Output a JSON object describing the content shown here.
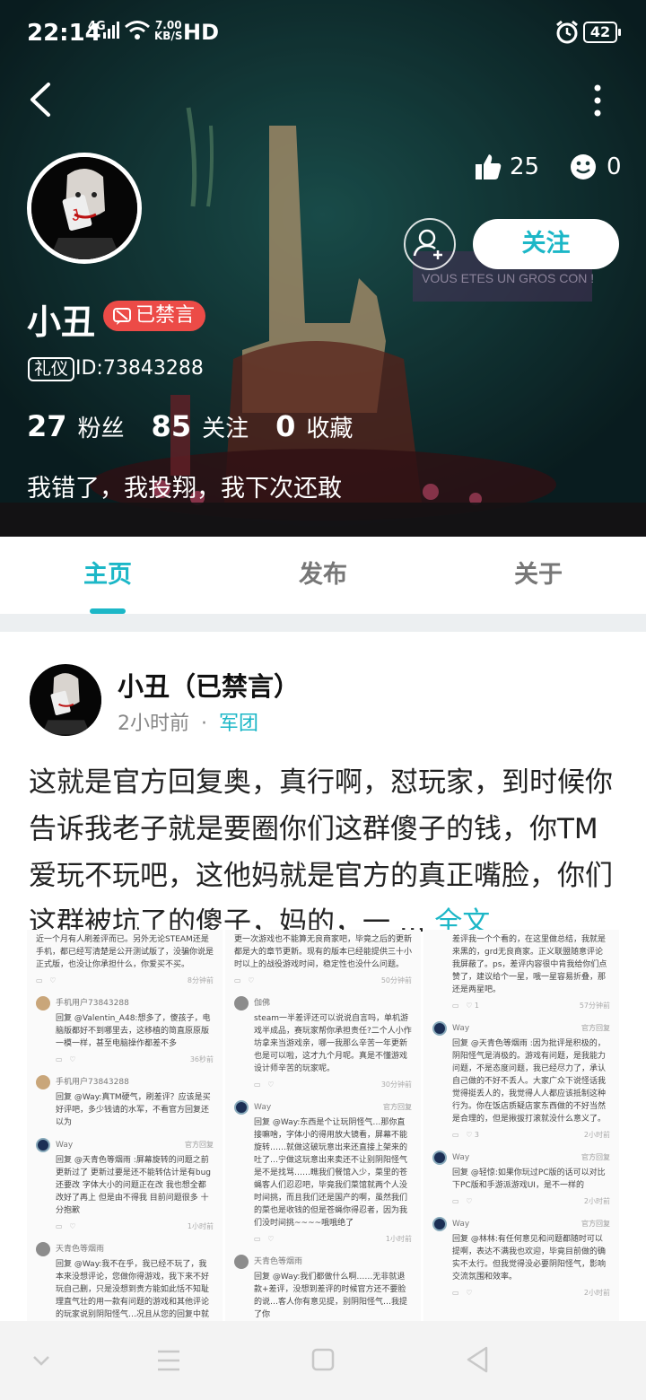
{
  "status_bar": {
    "time": "22:14",
    "network": "4G",
    "speed_value": "7.00",
    "speed_unit": "KB/S",
    "hd": "HD",
    "battery": "42"
  },
  "profile": {
    "name": "小丑",
    "banned_label": "已禁言",
    "etiquette_tag": "礼仪",
    "user_id": "ID:73843288",
    "likes": "25",
    "smiles": "0",
    "follow_label": "关注",
    "stats": [
      {
        "num": "27",
        "label": "粉丝"
      },
      {
        "num": "85",
        "label": "关注"
      },
      {
        "num": "0",
        "label": "收藏"
      }
    ],
    "signature": "我错了，我投翔，我下次还敢",
    "bg_sign_text": "VOUS ETES UN GROS CON !"
  },
  "tabs": [
    {
      "label": "主页",
      "active": true
    },
    {
      "label": "发布",
      "active": false
    },
    {
      "label": "关于",
      "active": false
    }
  ],
  "post": {
    "author": "小丑（已禁言）",
    "time": "2小时前",
    "separator": "·",
    "group": "军团",
    "text": "这就是官方回复奥，真行啊，怼玩家，到时候你告诉我老子就是要圈你们这群傻子的钱，你TM爱玩不玩吧，这他妈就是官方的真正嘴脸，你们这群被坑了的傻子，妈的，一 ... ",
    "full_text_link": "全文"
  },
  "gallery": {
    "col1": {
      "c1_body": "近一个月有人刷差评而已。另外无论STEAM还是手机，都已经写清楚是公开测试版了，没骗你说是正式版，也没让你承担什么，你爱买不买。",
      "c1_time": "8分钟前",
      "c2_user": "手机用户73843288",
      "c2_body": "回复 @Valentin_A48:想多了，傻孩子，电脑版都好不到哪里去，这移植的简直原原版一模一样，甚至电脑操作都差不多",
      "c2_time": "36秒前",
      "c3_user": "手机用户73843288",
      "c3_body": "回复 @Way:真TM硬气，刷差评？应该是买好评吧，多少钱请的水军，不看官方回复还以为",
      "c4_user": "Way",
      "c4_official": "官方回复",
      "c4_body": "回复 @天青色等烟雨 :屏幕旋转的问题之前更新过了 更新过要是还不能转估计是有bug还要改 字体大小的问题正在改 我也想全都改好了再上 但是由不得我 目前问题很多 十分抱歉",
      "c4_time": "1小时前",
      "c5_user": "天青色等烟雨",
      "c5_body": "回复 @Way:我不在乎，我已经不玩了，我本来没想评论，您做你得游戏，我下来不好玩自己删，只是没想到贵方能如此恬不知耻理直气壮的用一款有问题的游戏和其他评论的玩家说别阴阳怪气…况且从您的回复中就能看出…问题还是没解决，那你有什么好说的"
    },
    "col2": {
      "c1_body": "更一次游戏也不能算无良商家吧，毕竟之后的更新都是大的章节更新。现有的版本已经能提供三十小时以上的战役游戏时间，稳定性也没什么问题。",
      "c1_time": "50分钟前",
      "c2_user": "伽佛",
      "c2_body": "steam一半差评还可以说说自言吗，单机游戏半成品，赛玩家帮你承担责任?二个人小作坊拿来当游戏亲，哪一我那么辛苦一年更新也是可以啦，这才九个月呢。真是不懂游戏设计师辛苦的玩家呢。",
      "c2_time": "30分钟前",
      "c3_user": "Way",
      "c3_official": "官方回复",
      "c3_body": "回复 @Way:东西是个让玩阴怪气…那你直接嘛啥，字体小的得用放大镜看，屏幕不能旋转……就做这破玩意出来还直接上架来的吐了…宁做这玩意出来卖还不让别阴阳怪气是不是找骂……瞧我们餐馆入少，菜里的苍蝇客人们忍忍吧，毕竟我们菜馆就两个人没时间挑，而且我们还是国产的啊，虽然我们的菜也是收钱的但是苍蝇你得忍者，因为我们没时间挑~~~~哦哦绝了",
      "c3_time": "1小时前",
      "c4_user": "天青色等烟雨",
      "c4_body": "回复 @Way:我们都做什么啊……无非就退款+差评，没想到差评的时候官方还不要脸的说…客人你有意见提，别阴阳怪气…我提了你"
    },
    "col3": {
      "c1_body": "差评我一个个看的，在这里做总结，我就是来黑的，grd无良商家。正义联盟随意评论我屏蔽了。ps，差评内容很中肯我给你们点赞了，建议给个一星，哦一星容易折叠，那还是两星吧。",
      "c1_likes": "1",
      "c1_time": "57分钟前",
      "c2_user": "Way",
      "c2_official": "官方回复",
      "c2_body": "回复 @天青色等烟雨 :因为批评是积极的，阴阳怪气是消极的。游戏有问题，是我能力问题，不是态度问题，我已经尽力了，承认自己做的不好不丢人。大家广众下说怪话我觉得挺丢人的，我觉得人人都应该抵制这种行为。你在饭店质疑店家东西做的不好当然是合理的，但是揪拔打滚就没什么意义了。",
      "c2_likes": "3",
      "c2_time": "2小时前",
      "c3_user": "Way",
      "c3_official": "官方回复",
      "c3_body": "回复 @轻惊:如果你玩过PC版的话可以对比下PC版和手游派游戏UI，是不一样的",
      "c3_time": "2小时前",
      "c4_user": "Way",
      "c4_official": "官方回复",
      "c4_body": "回复 @林林:有任何意见和问题都随时可以提啊，表达不满我也欢迎，毕竟目前做的确实不太行。但我觉得没必要阴阳怪气，影响交流氛围和效率。",
      "c4_time": "2小时前"
    }
  },
  "colors": {
    "accent": "#1cb7c7",
    "banned": "#ec4b47",
    "tab_inactive": "#777777",
    "divider": "#eceff1"
  },
  "icons": [
    "back-arrow-icon",
    "more-vertical-icon",
    "thumbs-up-icon",
    "smile-icon",
    "add-friend-icon",
    "banned-chat-icon",
    "nav-back-icon",
    "nav-home-icon",
    "nav-menu-icon",
    "nav-collapse-icon"
  ]
}
